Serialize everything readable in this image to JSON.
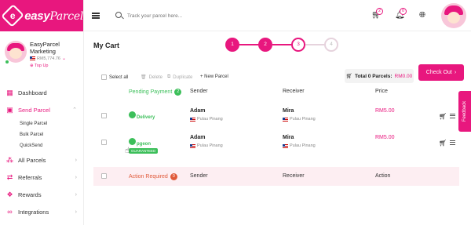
{
  "brand": {
    "logo_mark": "e",
    "name_a": "easy",
    "name_b": "Parcel",
    "accent": "#e8177e"
  },
  "profile": {
    "name_line1": "EasyParcel",
    "name_line2": "Marketing",
    "balance": "RM5,774.76",
    "topup": "Top Up"
  },
  "sidebar": {
    "items": [
      {
        "label": "Dashboard",
        "icon": "dashboard-icon"
      },
      {
        "label": "Send Parcel",
        "icon": "send-icon",
        "active": true
      },
      {
        "label": "All Parcels",
        "icon": "parcels-icon"
      },
      {
        "label": "Referrals",
        "icon": "referrals-icon"
      },
      {
        "label": "Rewards",
        "icon": "gift-icon"
      },
      {
        "label": "Integrations",
        "icon": "link-icon"
      }
    ],
    "sub_items": [
      "Single Parcel",
      "Bulk Parcel",
      "QuickSend"
    ]
  },
  "header": {
    "search_placeholder": "Track your parcel here...",
    "cart_count": "2",
    "notif_count": "0"
  },
  "page": {
    "title": "My Cart"
  },
  "stepper": {
    "steps": [
      "1",
      "2",
      "3",
      "4"
    ],
    "current": 3
  },
  "toolbar": {
    "select_all": "Select all",
    "delete": "Delete",
    "duplicate": "Duplicate",
    "new_parcel": "+ New Parcel",
    "total_label": "Total 0 Parcels:",
    "total_amount": "RM0.00",
    "checkout": "Check Out"
  },
  "table": {
    "pending_label": "Pending Payment",
    "pending_count": "2",
    "columns": [
      "Sender",
      "Receiver",
      "Price"
    ],
    "rows": [
      {
        "courier_line1": "Delivery",
        "courier_line2": "",
        "sender": "Adam",
        "sender_loc": "Pulau Pinang",
        "receiver": "Mira",
        "receiver_loc": "Pulau Pinang",
        "price": "RM5.00"
      },
      {
        "courier_line1": "pgeon",
        "courier_line2": "GUARANTEED",
        "sender": "Adam",
        "sender_loc": "Pulau Pinang",
        "receiver": "Mira",
        "receiver_loc": "Pulau Pinang",
        "price": "RM5.00"
      }
    ]
  },
  "action_bar": {
    "label": "Action Required",
    "count": "0",
    "columns": [
      "Sender",
      "Receiver",
      "Action"
    ]
  },
  "feedback": "Feedback"
}
